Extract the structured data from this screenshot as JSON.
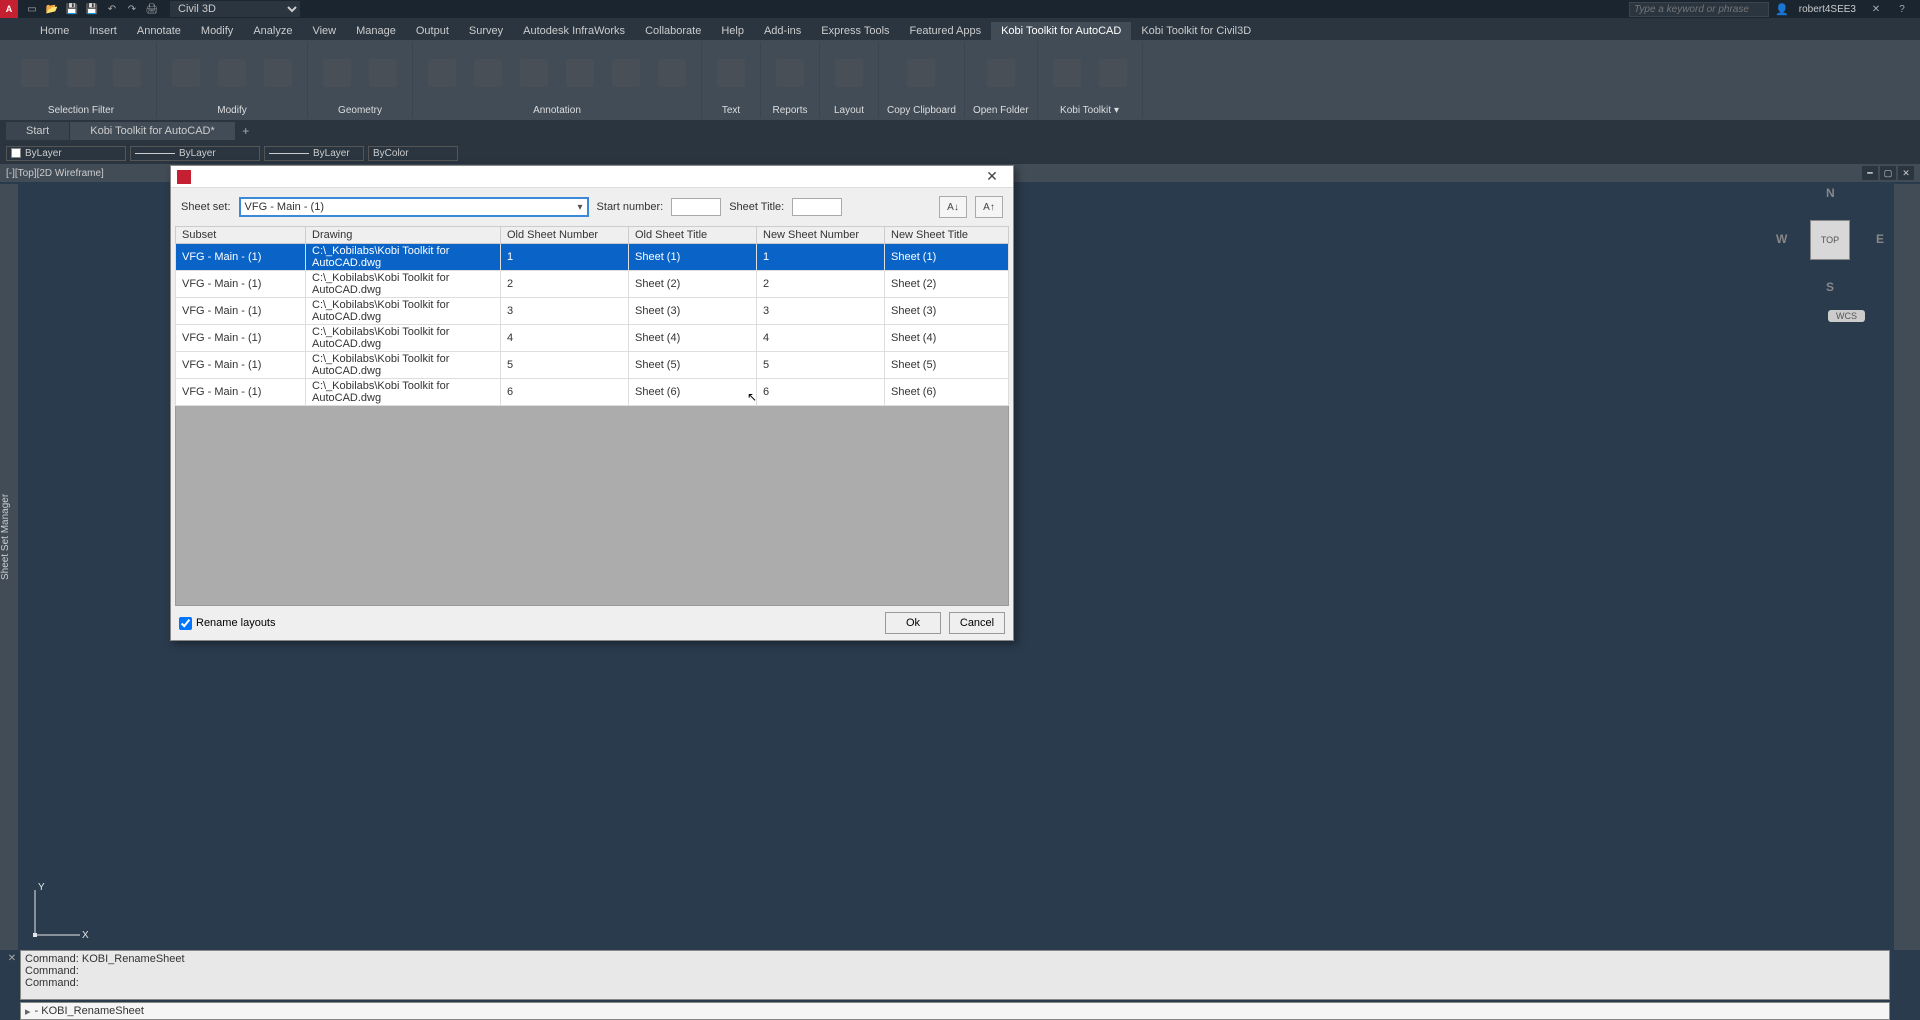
{
  "app": {
    "workspace": "Civil 3D",
    "search_placeholder": "Type a keyword or phrase",
    "user": "robert4SEE3"
  },
  "ribbon": {
    "tabs": [
      "Home",
      "Insert",
      "Annotate",
      "Modify",
      "Analyze",
      "View",
      "Manage",
      "Output",
      "Survey",
      "Autodesk InfraWorks",
      "Collaborate",
      "Help",
      "Add-ins",
      "Express Tools",
      "Featured Apps",
      "Kobi Toolkit for AutoCAD",
      "Kobi Toolkit for Civil3D"
    ],
    "active_tab": "Kobi Toolkit for AutoCAD",
    "panels": [
      "Selection Filter",
      "Modify",
      "Geometry",
      "Annotation",
      "Text",
      "Reports",
      "Layout",
      "Copy Clipboard",
      "Open Folder",
      "Kobi Toolkit"
    ]
  },
  "doc_tabs": {
    "items": [
      "Start",
      "Kobi Toolkit for AutoCAD*"
    ],
    "active": 1
  },
  "props": {
    "layer": "ByLayer",
    "linetype": "ByLayer",
    "lineweight": "ByLayer",
    "color": "ByColor"
  },
  "viewport": {
    "label": "[-][Top][2D Wireframe]"
  },
  "navcube": {
    "face": "TOP",
    "n": "N",
    "s": "S",
    "e": "E",
    "w": "W",
    "wcs": "WCS"
  },
  "sidebar_left": "Sheet Set Manager",
  "command": {
    "history": [
      "Command: KOBI_RenameSheet",
      "Command:",
      "Command:"
    ],
    "input": "- KOBI_RenameSheet"
  },
  "dialog": {
    "labels": {
      "sheet_set": "Sheet set:",
      "start_number": "Start number:",
      "sheet_title": "Sheet Title:",
      "rename_layouts": "Rename layouts",
      "ok": "Ok",
      "cancel": "Cancel"
    },
    "sheet_set_value": "VFG - Main - (1)",
    "start_number_value": "",
    "sheet_title_value": "",
    "columns": [
      "Subset",
      "Drawing",
      "Old Sheet Number",
      "Old Sheet Title",
      "New Sheet Number",
      "New Sheet Title"
    ],
    "rows": [
      {
        "subset": "VFG - Main - (1)",
        "drawing": "C:\\_Kobilabs\\Kobi Toolkit for AutoCAD.dwg",
        "old_num": "1",
        "old_title": "Sheet (1)",
        "new_num": "1",
        "new_title": "Sheet (1)"
      },
      {
        "subset": "VFG - Main - (1)",
        "drawing": "C:\\_Kobilabs\\Kobi Toolkit for AutoCAD.dwg",
        "old_num": "2",
        "old_title": "Sheet (2)",
        "new_num": "2",
        "new_title": "Sheet (2)"
      },
      {
        "subset": "VFG - Main - (1)",
        "drawing": "C:\\_Kobilabs\\Kobi Toolkit for AutoCAD.dwg",
        "old_num": "3",
        "old_title": "Sheet (3)",
        "new_num": "3",
        "new_title": "Sheet (3)"
      },
      {
        "subset": "VFG - Main - (1)",
        "drawing": "C:\\_Kobilabs\\Kobi Toolkit for AutoCAD.dwg",
        "old_num": "4",
        "old_title": "Sheet (4)",
        "new_num": "4",
        "new_title": "Sheet (4)"
      },
      {
        "subset": "VFG - Main - (1)",
        "drawing": "C:\\_Kobilabs\\Kobi Toolkit for AutoCAD.dwg",
        "old_num": "5",
        "old_title": "Sheet (5)",
        "new_num": "5",
        "new_title": "Sheet (5)"
      },
      {
        "subset": "VFG - Main - (1)",
        "drawing": "C:\\_Kobilabs\\Kobi Toolkit for AutoCAD.dwg",
        "old_num": "6",
        "old_title": "Sheet (6)",
        "new_num": "6",
        "new_title": "Sheet (6)"
      }
    ]
  }
}
